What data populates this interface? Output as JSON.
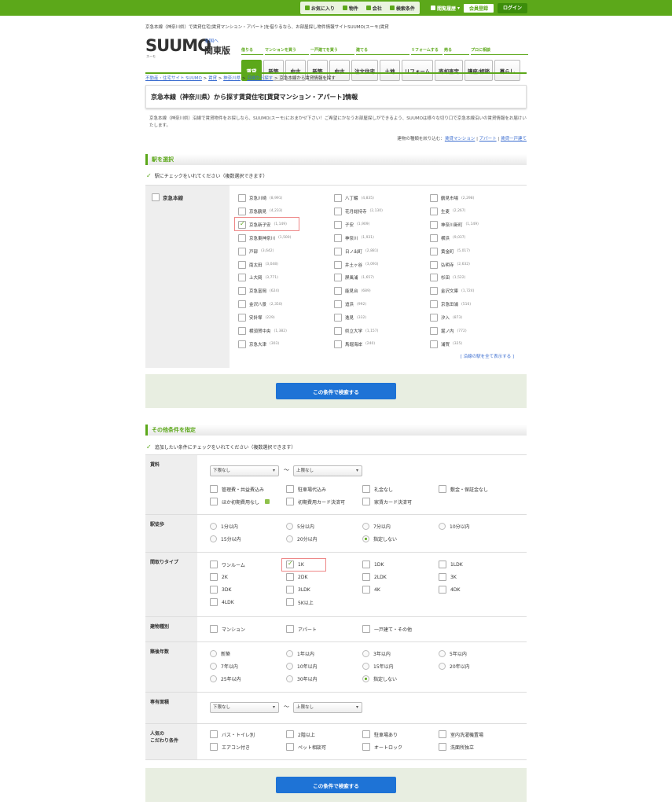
{
  "topbar": {
    "favorites": "お気に入り",
    "property": "物件",
    "company": "会社",
    "conditions": "検索条件",
    "history": "閲覧履歴",
    "member": "会員登録",
    "login": "ログイン"
  },
  "header": {
    "tagline": "京急本線（神奈川県）で賃貸住宅[賃貸マンション・アパート]を借りるなら、お部屋探し物件情報サイトSUUMO(スーモ)賃貸",
    "logo": "SUUMO",
    "logo_sub": "スーモ",
    "region_link": "全国へ",
    "region": "関東版",
    "cats": [
      {
        "label": "借りる"
      },
      {
        "label": "マンションを買う"
      },
      {
        "label": "一戸建てを買う"
      },
      {
        "label": "建てる"
      },
      {
        "label": "リフォームする"
      },
      {
        "label": "売る"
      },
      {
        "label": "プロに相談"
      }
    ],
    "nav": [
      "賃貸",
      "新築",
      "中古",
      "新築",
      "中古",
      "注文住宅",
      "土地",
      "リフォーム",
      "売却査定",
      "講座/相談",
      "暮らし"
    ]
  },
  "breadcrumb": {
    "b1": "不動産・住宅サイト SUUMO",
    "b2": "賃貸",
    "b3": "神奈川県",
    "b4": "沿線から探す",
    "current": "京急本線から賃貸情報を探す",
    "sep": ">"
  },
  "title": "京急本線（神奈川県）から探す賃貸住宅[賃貸マンション・アパート]情報",
  "intro": "京急本線（神奈川県）沿線で賃貸物件をお探しなら、SUUMO(スーモ)におまかせ下さい！ご希望にかなうお部屋探しができるよう、SUUMOは様々な切り口で京急本線沿いの賃貸情報をお届けいたします。",
  "narrow": {
    "label": "建物の種類を絞り込む：",
    "l1": "賃貸マンション",
    "l2": "アパート",
    "l3": "賃貸一戸建て",
    "sep": "|"
  },
  "station_section": {
    "heading": "駅を選択",
    "instr": "駅にチェックをいれてください（複数選択できます）",
    "line": "京急本線",
    "all_link": "[ 沿線の駅を全て表示する ]",
    "stations": [
      [
        "京急川崎",
        "(8,991)",
        false
      ],
      [
        "八丁畷",
        "(4,835)",
        false
      ],
      [
        "鶴見市場",
        "(2,298)",
        false
      ],
      [
        "京急鶴見",
        "(4,233)",
        false
      ],
      [
        "花月総持寺",
        "(2,130)",
        false
      ],
      [
        "生麦",
        "(2,267)",
        false
      ],
      [
        "京急新子安",
        "(1,149)",
        true
      ],
      [
        "子安",
        "(1,909)",
        false
      ],
      [
        "神奈川新町",
        "(1,149)",
        false
      ],
      [
        "京急東神奈川",
        "(1,500)",
        false
      ],
      [
        "神奈川",
        "(1,931)",
        false
      ],
      [
        "横浜",
        "(9,037)",
        false
      ],
      [
        "戸部",
        "(3,642)",
        false
      ],
      [
        "日ノ出町",
        "(2,881)",
        false
      ],
      [
        "黄金町",
        "(5,017)",
        false
      ],
      [
        "南太田",
        "(3,048)",
        false
      ],
      [
        "井土ヶ谷",
        "(3,093)",
        false
      ],
      [
        "弘明寺",
        "(2,632)",
        false
      ],
      [
        "上大岡",
        "(3,771)",
        false
      ],
      [
        "屏風浦",
        "(1,657)",
        false
      ],
      [
        "杉田",
        "(1,522)",
        false
      ],
      [
        "京急富岡",
        "(624)",
        false
      ],
      [
        "能見台",
        "(689)",
        false
      ],
      [
        "金沢文庫",
        "(1,724)",
        false
      ],
      [
        "金沢八景",
        "(2,350)",
        false
      ],
      [
        "追浜",
        "(992)",
        false
      ],
      [
        "京急田浦",
        "(516)",
        false
      ],
      [
        "安針塚",
        "(229)",
        false
      ],
      [
        "逸見",
        "(332)",
        false
      ],
      [
        "汐入",
        "(873)",
        false
      ],
      [
        "横須賀中央",
        "(1,382)",
        false
      ],
      [
        "県立大学",
        "(1,157)",
        false
      ],
      [
        "堀ノ内",
        "(772)",
        false
      ],
      [
        "京急大津",
        "(303)",
        false
      ],
      [
        "馬堀海岸",
        "(240)",
        false
      ],
      [
        "浦賀",
        "(325)",
        false
      ]
    ]
  },
  "search_button": "この条件で検索する",
  "other_section": {
    "heading": "その他条件を指定",
    "instr": "追加したい条件にチェックをいれてください（複数選択できます）"
  },
  "rent": {
    "label": "賃料",
    "min": "下限なし",
    "max": "上限なし",
    "tilde": "〜",
    "opts": [
      "管理費・共益費込み",
      "駐車場代込み",
      "礼金なし",
      "敷金・保証金なし",
      "ほか初期費用なし",
      "初期費用カード決済可",
      "家賃カード決済可"
    ]
  },
  "walk": {
    "label": "駅徒歩",
    "opts": [
      [
        "1分以内",
        false
      ],
      [
        "5分以内",
        false
      ],
      [
        "7分以内",
        false
      ],
      [
        "10分以内",
        false
      ],
      [
        "15分以内",
        false
      ],
      [
        "20分以内",
        false
      ],
      [
        "指定しない",
        true
      ]
    ]
  },
  "layout": {
    "label": "間取りタイプ",
    "opts": [
      [
        "ワンルーム",
        false
      ],
      [
        "1K",
        true
      ],
      [
        "1DK",
        false
      ],
      [
        "1LDK",
        false
      ],
      [
        "2K",
        false
      ],
      [
        "2DK",
        false
      ],
      [
        "2LDK",
        false
      ],
      [
        "3K",
        false
      ],
      [
        "3DK",
        false
      ],
      [
        "3LDK",
        false
      ],
      [
        "4K",
        false
      ],
      [
        "4DK",
        false
      ],
      [
        "4LDK",
        false
      ],
      [
        "5K以上",
        false
      ]
    ]
  },
  "building": {
    "label": "建物種別",
    "opts": [
      "マンション",
      "アパート",
      "一戸建て・その他"
    ]
  },
  "age": {
    "label": "築後年数",
    "opts": [
      [
        "新築",
        false
      ],
      [
        "1年以内",
        false
      ],
      [
        "3年以内",
        false
      ],
      [
        "5年以内",
        false
      ],
      [
        "7年以内",
        false
      ],
      [
        "10年以内",
        false
      ],
      [
        "15年以内",
        false
      ],
      [
        "20年以内",
        false
      ],
      [
        "25年以内",
        false
      ],
      [
        "30年以内",
        false
      ],
      [
        "指定しない",
        true
      ]
    ]
  },
  "area": {
    "label": "専有面積",
    "min": "下限なし",
    "max": "上限なし",
    "tilde": "〜"
  },
  "popular": {
    "label1": "人気の",
    "label2": "こだわり条件",
    "opts": [
      "バス・トイレ別",
      "2階以上",
      "駐車場あり",
      "室内洗濯機置場",
      "エアコン付き",
      "ペット相談可",
      "オートロック",
      "洗面所独立"
    ]
  }
}
